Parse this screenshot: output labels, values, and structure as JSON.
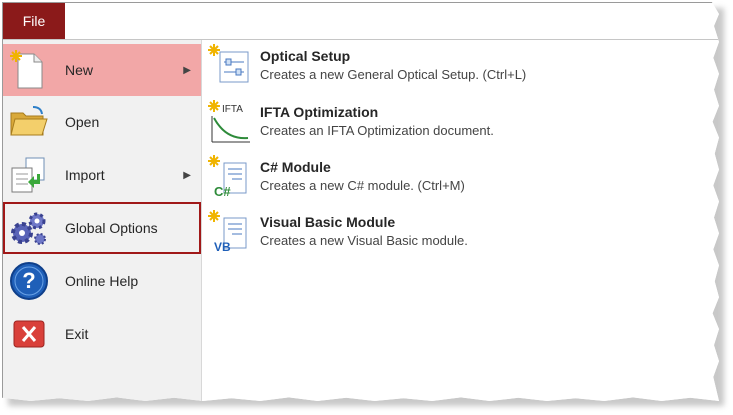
{
  "file_tab": "File",
  "menu": {
    "new": "New",
    "open": "Open",
    "import": "Import",
    "global_options": "Global Options",
    "online_help": "Online Help",
    "exit": "Exit",
    "selected": "New",
    "highlighted": "Global Options",
    "icons": [
      "new-document-icon",
      "folder-open-icon",
      "import-icon",
      "gears-icon",
      "help-icon",
      "exit-icon"
    ]
  },
  "submenu": [
    {
      "title": "Optical Setup",
      "desc": "Creates a new General Optical Setup. (Ctrl+L)",
      "icon": "optical-setup-icon"
    },
    {
      "title": "IFTA Optimization",
      "desc": "Creates an IFTA Optimization document.",
      "icon": "ifta-icon"
    },
    {
      "title": "C# Module",
      "desc": "Creates a new C# module. (Ctrl+M)",
      "icon": "csharp-module-icon"
    },
    {
      "title": "Visual Basic Module",
      "desc": "Creates a new Visual Basic module.",
      "icon": "vb-module-icon"
    }
  ],
  "icon_text": {
    "ifta": "IFTA",
    "csharp": "C#",
    "vb": "VB"
  },
  "colors": {
    "file_tab": "#8b1a1a",
    "selected_bg": "#f2a7a7",
    "highlight_border": "#a01818"
  }
}
